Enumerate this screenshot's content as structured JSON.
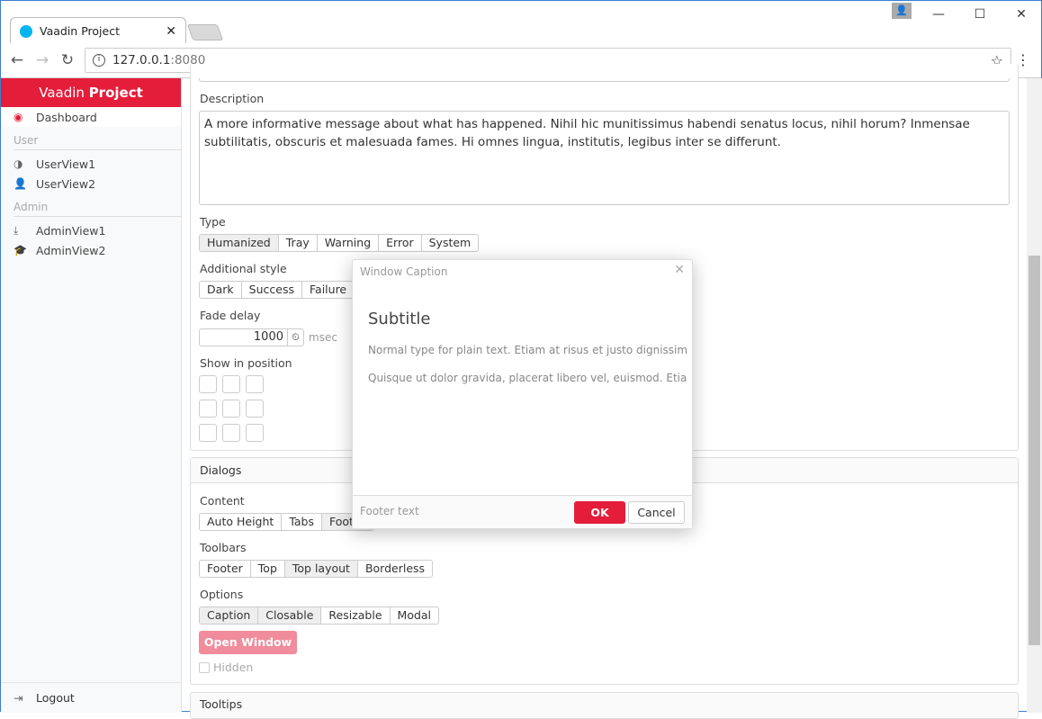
{
  "browser": {
    "tab_title": "Vaadin Project",
    "url_host": "127.0.0.1",
    "url_port": ":8080"
  },
  "sidebar": {
    "brand_light": "Vaadin",
    "brand_bold": "Project",
    "items": [
      {
        "label": "Dashboard",
        "icon": "dashboard-icon",
        "selected": true
      }
    ],
    "user_caption": "User",
    "user_items": [
      {
        "label": "UserView1",
        "icon": "adjust-icon"
      },
      {
        "label": "UserView2",
        "icon": "user-icon"
      }
    ],
    "admin_caption": "Admin",
    "admin_items": [
      {
        "label": "AdminView1",
        "icon": "sign-in-icon"
      },
      {
        "label": "AdminView2",
        "icon": "graduation-cap-icon"
      }
    ],
    "logout": "Logout"
  },
  "notifications": {
    "description_label": "Description",
    "description": "A more informative message about what has happened. Nihil hic munitissimus habendi senatus locus, nihil horum? Inmensae subtilitatis, obscuris et malesuada fames. Hi omnes lingua, institutis, legibus inter se differunt.",
    "type_label": "Type",
    "types": [
      "Humanized",
      "Tray",
      "Warning",
      "Error",
      "System"
    ],
    "type_selected": "Humanized",
    "style_label": "Additional style",
    "styles": [
      "Dark",
      "Success",
      "Failure"
    ],
    "fade_label": "Fade delay",
    "fade_value": "1000",
    "fade_unit": "msec",
    "position_label": "Show in position"
  },
  "dialogs": {
    "title": "Dialogs",
    "content_label": "Content",
    "content": [
      "Auto Height",
      "Tabs",
      "Footer"
    ],
    "toolbars_label": "Toolbars",
    "toolbars": [
      "Footer",
      "Top",
      "Top layout",
      "Borderless"
    ],
    "options_label": "Options",
    "options": [
      "Caption",
      "Closable",
      "Resizable",
      "Modal"
    ],
    "open_window": "Open Window",
    "hidden": "Hidden"
  },
  "tooltips": {
    "title": "Tooltips"
  },
  "window": {
    "caption": "Window Caption",
    "subtitle": "Subtitle",
    "p1": "Normal type for plain text. Etiam at risus et justo dignissim congue",
    "p2": "Quisque ut dolor gravida, placerat libero vel, euismod. Etiam habe",
    "footer_text": "Footer text",
    "ok": "OK",
    "cancel": "Cancel"
  },
  "colors": {
    "accent": "#e41d3b"
  }
}
